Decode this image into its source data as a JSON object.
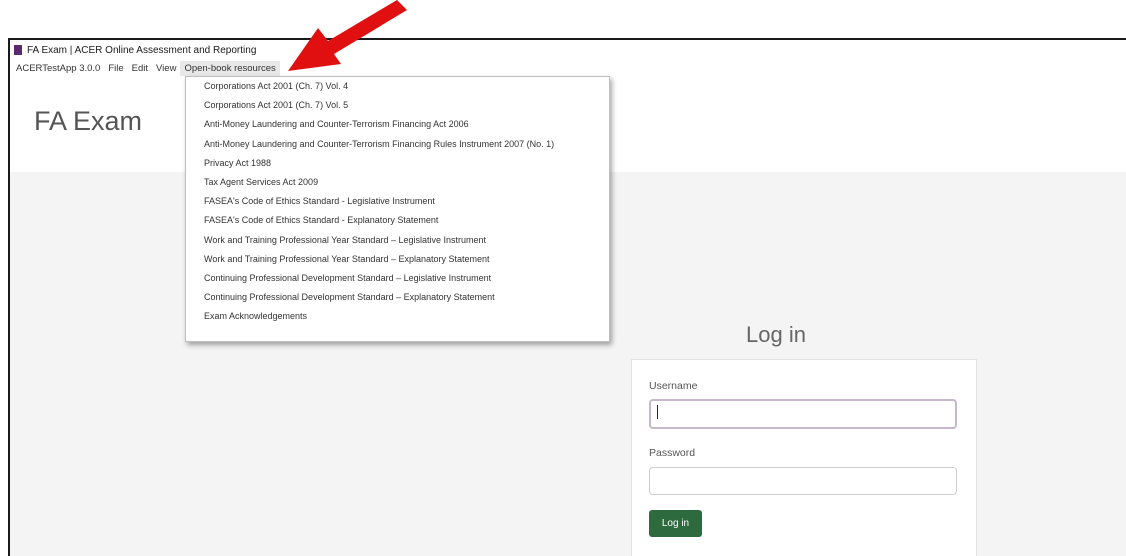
{
  "window": {
    "title": "FA Exam | ACER Online Assessment and Reporting"
  },
  "menubar": {
    "items": [
      "ACERTestApp 3.0.0",
      "File",
      "Edit",
      "View",
      "Open-book resources"
    ]
  },
  "brand": "FA Exam",
  "resources_menu": {
    "items": [
      "Corporations Act 2001 (Ch. 7) Vol. 4",
      "Corporations Act 2001 (Ch. 7) Vol. 5",
      "Anti-Money Laundering and Counter-Terrorism Financing Act 2006",
      "Anti-Money Laundering and Counter-Terrorism Financing Rules Instrument 2007 (No. 1)",
      "Privacy Act 1988",
      "Tax Agent Services Act 2009",
      "FASEA's Code of Ethics Standard - Legislative Instrument",
      "FASEA's Code of Ethics Standard - Explanatory Statement",
      "Work and Training Professional Year Standard – Legislative Instrument",
      "Work and Training Professional Year Standard – Explanatory Statement",
      "Continuing Professional Development Standard – Legislative Instrument",
      "Continuing Professional Development Standard – Explanatory Statement",
      "Exam Acknowledgements"
    ]
  },
  "login": {
    "title": "Log in",
    "username_label": "Username",
    "username_value": "",
    "password_label": "Password",
    "password_value": "",
    "button_label": "Log in"
  },
  "colors": {
    "login_button": "#2d6a3e",
    "annotation_arrow": "#e01010",
    "content_background": "#f4f4f4"
  }
}
